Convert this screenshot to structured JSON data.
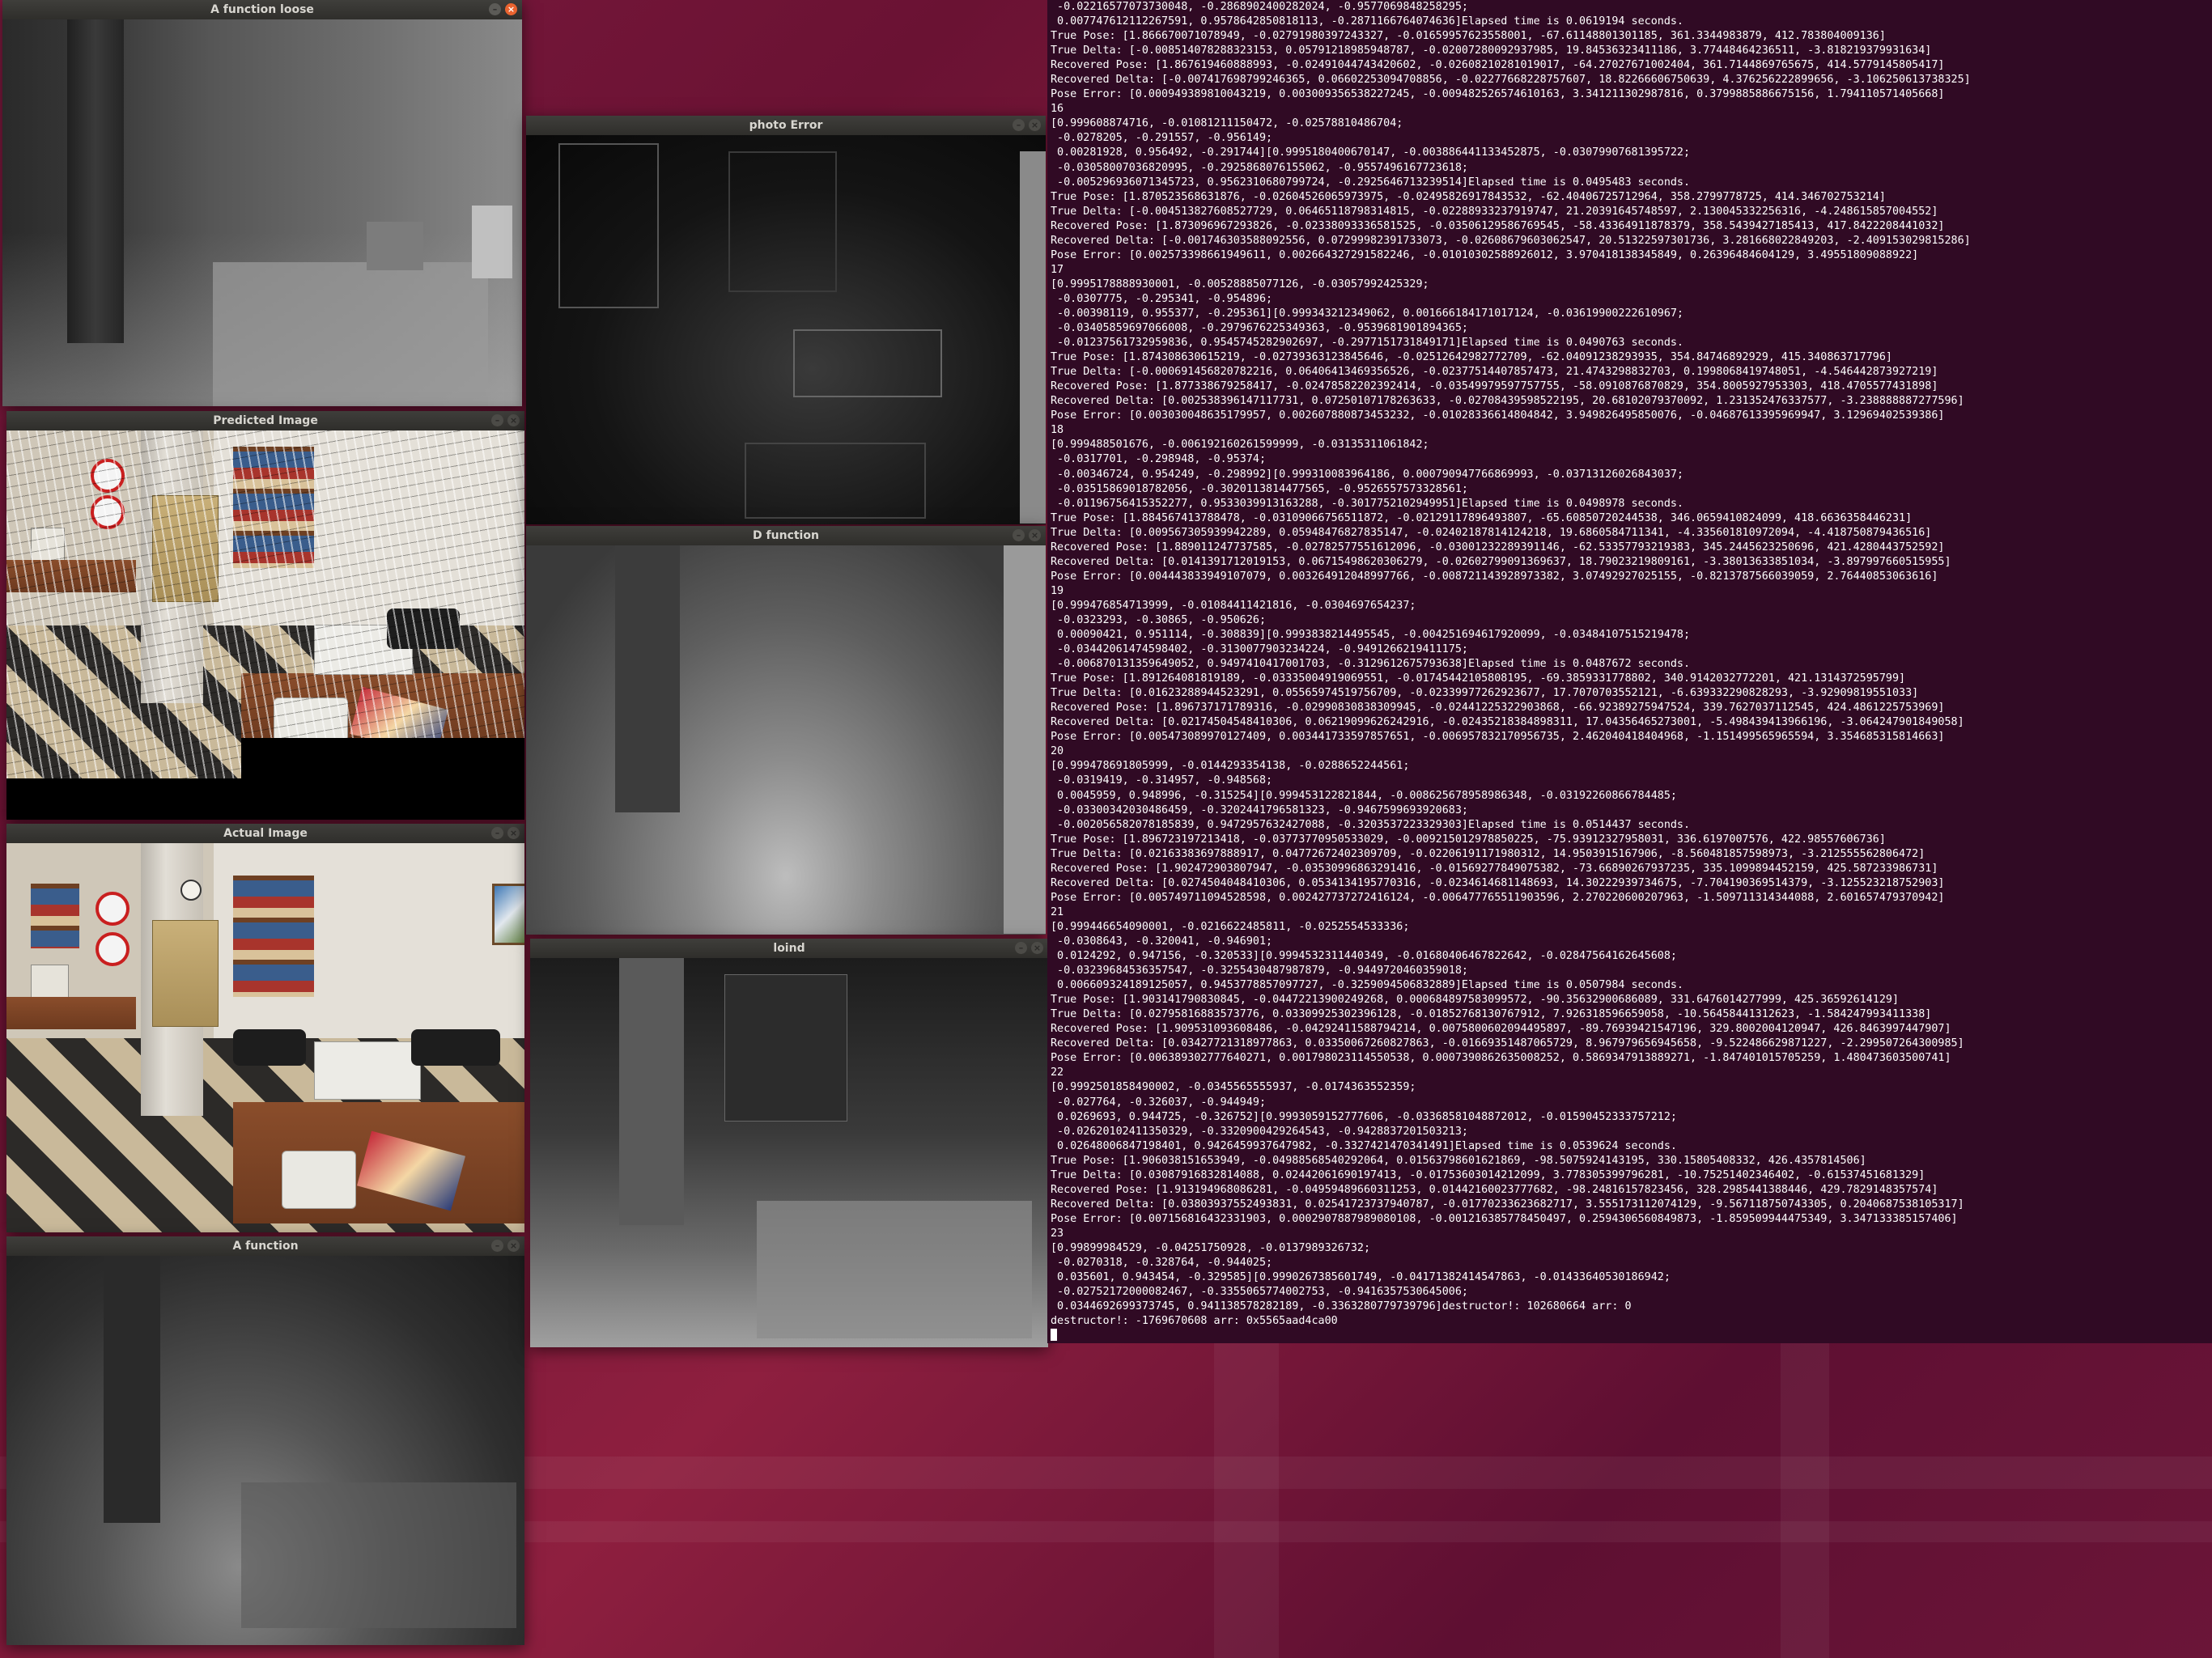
{
  "windows": {
    "a_function_loose": {
      "title": "A function loose"
    },
    "predicted_image": {
      "title": "Predicted Image"
    },
    "actual_image": {
      "title": "Actual Image"
    },
    "a_function": {
      "title": "A function"
    },
    "photo_error": {
      "title": "photo Error"
    },
    "d_function": {
      "title": "D function"
    },
    "loind": {
      "title": "loind"
    }
  },
  "terminal": {
    "lines": [
      " -0.02216577073730048, -0.2868902400282024, -0.9577069848258295;",
      " 0.007747612112267591, 0.9578642850818113, -0.2871166764074636]Elapsed time is 0.0619194 seconds.",
      "True Pose: [1.866670071078949, -0.02791980397243327, -0.01659957623558001, -67.61148801301185, 361.3344983879, 412.783804009136]",
      "True Delta: [-0.008514078288323153, 0.05791218985948787, -0.02007280092937985, 19.84536323411186, 3.77448464236511, -3.818219379931634]",
      "Recovered Pose: [1.867619460888993, -0.02491044743420602, -0.02608210281019017, -64.27027671002404, 361.7144869765675, 414.5779145805417]",
      "Recovered Delta: [-0.007417698799246365, 0.06602253094708856, -0.02277668228757607, 18.82266606750639, 4.376256222899656, -3.106250613738325]",
      "Pose Error: [0.000949389810043219, 0.003009356538227245, -0.009482526574610163, 3.341211302987816, 0.3799885886675156, 1.794110571405668]",
      "16",
      "[0.999608874716, -0.01081211150472, -0.02578810486704;",
      " -0.0278205, -0.291557, -0.956149;",
      " 0.00281928, 0.956492, -0.291744][0.9995180400670147, -0.003886441133452875, -0.03079907681395722;",
      " -0.03058007036820995, -0.2925868076155062, -0.9557496167723618;",
      " -0.005296936071345723, 0.9562310680799724, -0.2925646713239514]Elapsed time is 0.0495483 seconds.",
      "True Pose: [1.870523568631876, -0.02604526065973975, -0.02495826917843532, -62.40406725712964, 358.2799778725, 414.346702753214]",
      "True Delta: [-0.004513827608527729, 0.06465118798314815, -0.02288933237919747, 21.20391645748597, 2.130045332256316, -4.248615857004552]",
      "Recovered Pose: [1.873096967293826, -0.02338093336581525, -0.03506129586769545, -58.43364911878379, 358.5439427185413, 417.8422208441032]",
      "Recovered Delta: [-0.001746303588092556, 0.07299982391733073, -0.02608679603062547, 20.51322597301736, 3.281668022849203, -2.409153029815286]",
      "Pose Error: [0.002573398661949611, 0.002664327291582246, -0.01010302588926012, 3.970418138345849, 0.26396484604129, 3.49551809088922]",
      "17",
      "[0.9995178888930001, -0.00528885077126, -0.03057992425329;",
      " -0.0307775, -0.295341, -0.954896;",
      " -0.00398119, 0.955377, -0.295361][0.999343212349062, 0.001666184171017124, -0.03619900222610967;",
      " -0.03405859697066008, -0.2979676225349363, -0.9539681901894365;",
      " -0.01237561732959836, 0.9545745282902697, -0.2977151731849171]Elapsed time is 0.0490763 seconds.",
      "True Pose: [1.874308630615219, -0.02739363123845646, -0.02512642982772709, -62.04091238293935, 354.84746892929, 415.340863717796]",
      "True Delta: [-0.000691456820782216, 0.06406413469356526, -0.02377514407857473, 21.4743298832703, 0.1998068419748051, -4.546442873927219]",
      "Recovered Pose: [1.877338679258417, -0.02478582202392414, -0.03549979597757755, -58.0910876870829, 354.8005927953303, 418.4705577431898]",
      "Recovered Delta: [0.002538396147117731, 0.07250107178263633, -0.02708439598522195, 20.68102079370092, 1.231352476337577, -3.238888887277596]",
      "Pose Error: [0.003030048635179957, 0.002607880873453232, -0.01028336614804842, 3.949826495850076, -0.04687613395969947, 3.12969402539386]",
      "18",
      "[0.999488501676, -0.006192160261599999, -0.03135311061842;",
      " -0.0317701, -0.298948, -0.95374;",
      " -0.00346724, 0.954249, -0.298992][0.999310083964186, 0.000790947766869993, -0.03713126026843037;",
      " -0.03515869018782056, -0.3020113814477565, -0.9526557573328561;",
      " -0.01196756415352277, 0.9533039913163288, -0.3017752102949951]Elapsed time is 0.0498978 seconds.",
      "True Pose: [1.884567413788478, -0.03109066756511872, -0.02129117896493807, -65.60850720244538, 346.0659410824099, 418.6636358446231]",
      "True Delta: [0.009567305939942289, 0.05948476827835147, -0.02402187814124218, 19.6860584711341, -4.335601810972094, -4.418750879436516]",
      "Recovered Pose: [1.889011247737585, -0.02782577551612096, -0.03001232289391146, -62.53357793219383, 345.2445623250696, 421.4280443752592]",
      "Recovered Delta: [0.0141391712019153, 0.06715498620306279, -0.02602799091369637, 18.79023219809161, -3.38013633851034, -3.897997660515955]",
      "Pose Error: [0.004443833949107079, 0.003264912048997766, -0.008721143928973382, 3.07492927025155, -0.8213787566039059, 2.76440853063616]",
      "19",
      "[0.999476854713999, -0.01084411421816, -0.0304697654237;",
      " -0.0323293, -0.30865, -0.950626;",
      " 0.00090421, 0.951114, -0.308839][0.9993838214495545, -0.004251694617920099, -0.03484107515219478;",
      " -0.03442061474598402, -0.3130077903234224, -0.9491266219411175;",
      " -0.006870131359649052, 0.9497410417001703, -0.3129612675793638]Elapsed time is 0.0487672 seconds.",
      "True Pose: [1.891264081819189, -0.03335004919069551, -0.01745442105808195, -69.3859331778802, 340.9142032772201, 421.1314372595799]",
      "True Delta: [0.01623288944523291, 0.05565974519756709, -0.02339977262923677, 17.7070703552121, -6.639332290828293, -3.92909819551033]",
      "Recovered Pose: [1.896737171789316, -0.02990830838309945, -0.02441225322903868, -66.92389275947524, 339.7627037112545, 424.4861225753969]",
      "Recovered Delta: [0.02174504548410306, 0.06219099626242916, -0.02435218384898311, 17.04356465273001, -5.498439413966196, -3.064247901849058]",
      "Pose Error: [0.005473089970127409, 0.003441733597857651, -0.006957832170956735, 2.462040418404968, -1.151499565965594, 3.354685315814663]",
      "20",
      "[0.999478691805999, -0.0144293354138, -0.0288652244561;",
      " -0.0319419, -0.314957, -0.948568;",
      " 0.0045959, 0.948996, -0.315254][0.999453122821844, -0.008625678958986348, -0.03192260866784485;",
      " -0.03300342030486459, -0.3202441796581323, -0.9467599693920683;",
      " -0.002056582078185839, 0.9472957632427088, -0.3203537223329303]Elapsed time is 0.0514437 seconds.",
      "True Pose: [1.896723197213418, -0.03773770950533029, -0.009215012978850225, -75.93912327958031, 336.6197007576, 422.98557606736]",
      "True Delta: [0.02163383697888917, 0.04772672402309709, -0.02206191171980312, 14.9503915167906, -8.560481857598973, -3.212555562806472]",
      "Recovered Pose: [1.902472903807947, -0.03530996863291416, -0.01569277849075382, -73.66890267937235, 335.1099894452159, 425.587233986731]",
      "Recovered Delta: [0.0274504048410306, 0.0534134195770316, -0.0234614681148693, 14.30222939734675, -7.704190369514379, -3.125523218752903]",
      "Pose Error: [0.005749711094528598, 0.002427737272416124, -0.006477765511903596, 2.270220600207963, -1.509711314344088, 2.601657479370942]",
      "21",
      "[0.999446654090001, -0.0216622485811, -0.0252554533336;",
      " -0.0308643, -0.320041, -0.946901;",
      " 0.0124292, 0.947156, -0.320533][0.9994532311440349, -0.01680406467822642, -0.02847564162645608;",
      " -0.03239684536357547, -0.3255430487987879, -0.9449720460359018;",
      " 0.006609324189125057, 0.9453778857097727, -0.3259094506832889]Elapsed time is 0.0507984 seconds.",
      "True Pose: [1.903141790830845, -0.04472213900249268, 0.000684897583099572, -90.35632900686089, 331.6476014277999, 425.36592614129]",
      "True Delta: [0.02795816883573776, 0.03309925302396128, -0.01852768130767912, 7.926318596659058, -10.56458441312623, -1.584247993411338]",
      "Recovered Pose: [1.909531093608486, -0.04292411588794214, 0.0075800602094495897, -89.76939421547196, 329.8002004120947, 426.8463997447907]",
      "Recovered Delta: [0.03427721318977863, 0.03350067260827863, -0.01669351487065729, 8.967979656945658, -9.522486629871227, -2.299507264300985]",
      "Pose Error: [0.006389302777640271, 0.001798023114550538, 0.0007390862635008252, 0.5869347913889271, -1.847401015705259, 1.480473603500741]",
      "22",
      "[0.9992501858490002, -0.0345565555937, -0.0174363552359;",
      " -0.027764, -0.326037, -0.944949;",
      " 0.0269693, 0.944725, -0.326752][0.9993059152777606, -0.03368581048872012, -0.01590452333757212;",
      " -0.02620102411350329, -0.3320900429264543, -0.9428837201503213;",
      " 0.02648006847198401, 0.9426459937647982, -0.3327421470341491]Elapsed time is 0.0539624 seconds.",
      "True Pose: [1.906038151653949, -0.04988568540292064, 0.01563798601621869, -98.5075924143195, 330.15805408332, 426.4357814506]",
      "True Delta: [0.03087916832814088, 0.02442061690197413, -0.01753603014212099, 3.778305399796281, -10.75251402346402, -0.61537451681329]",
      "Recovered Pose: [1.913194968086281, -0.04959489660311253, 0.01442160023777682, -98.24816157823456, 328.2985441388446, 429.7829148357574]",
      "Recovered Delta: [0.03803937552493831, 0.02541723737940787, -0.01770233623682717, 3.555173112074129, -9.567118750743305, 0.2040687538105317]",
      "Pose Error: [0.007156816432331903, 0.0002907887989080108, -0.001216385778450497, 0.2594306560849873, -1.859509944475349, 3.347133385157406]",
      "23",
      "[0.99899984529, -0.04251750928, -0.0137989326732;",
      " -0.0270318, -0.328764, -0.944025;",
      " 0.035601, 0.943454, -0.329585][0.9990267385601749, -0.04171382414547863, -0.01433640530186942;",
      " -0.02752172000082467, -0.3355065774002753, -0.9416357530645006;",
      " 0.0344692699373745, 0.941138578282189, -0.3363280779739796]destructor!: 102680664 arr: 0",
      "destructor!: -1769670608 arr: 0x5565aad4ca00"
    ]
  }
}
